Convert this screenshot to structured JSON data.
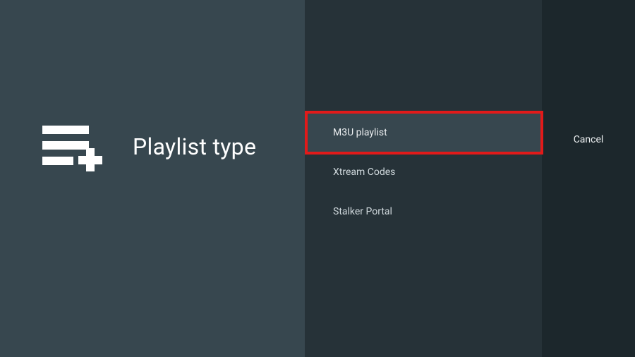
{
  "left": {
    "title": "Playlist type",
    "icon_name": "playlist-add-icon"
  },
  "options": [
    {
      "label": "M3U playlist",
      "selected": true
    },
    {
      "label": "Xtream Codes",
      "selected": false
    },
    {
      "label": "Stalker Portal",
      "selected": false
    }
  ],
  "right": {
    "cancel_label": "Cancel"
  },
  "annotation": {
    "highlight_target_index": 0
  },
  "colors": {
    "left_bg": "#37474f",
    "middle_bg": "#263238",
    "right_bg": "#1c272c",
    "highlight_border": "#e21a1a",
    "text_primary": "#ffffff",
    "text_secondary": "#cfd8dc"
  }
}
